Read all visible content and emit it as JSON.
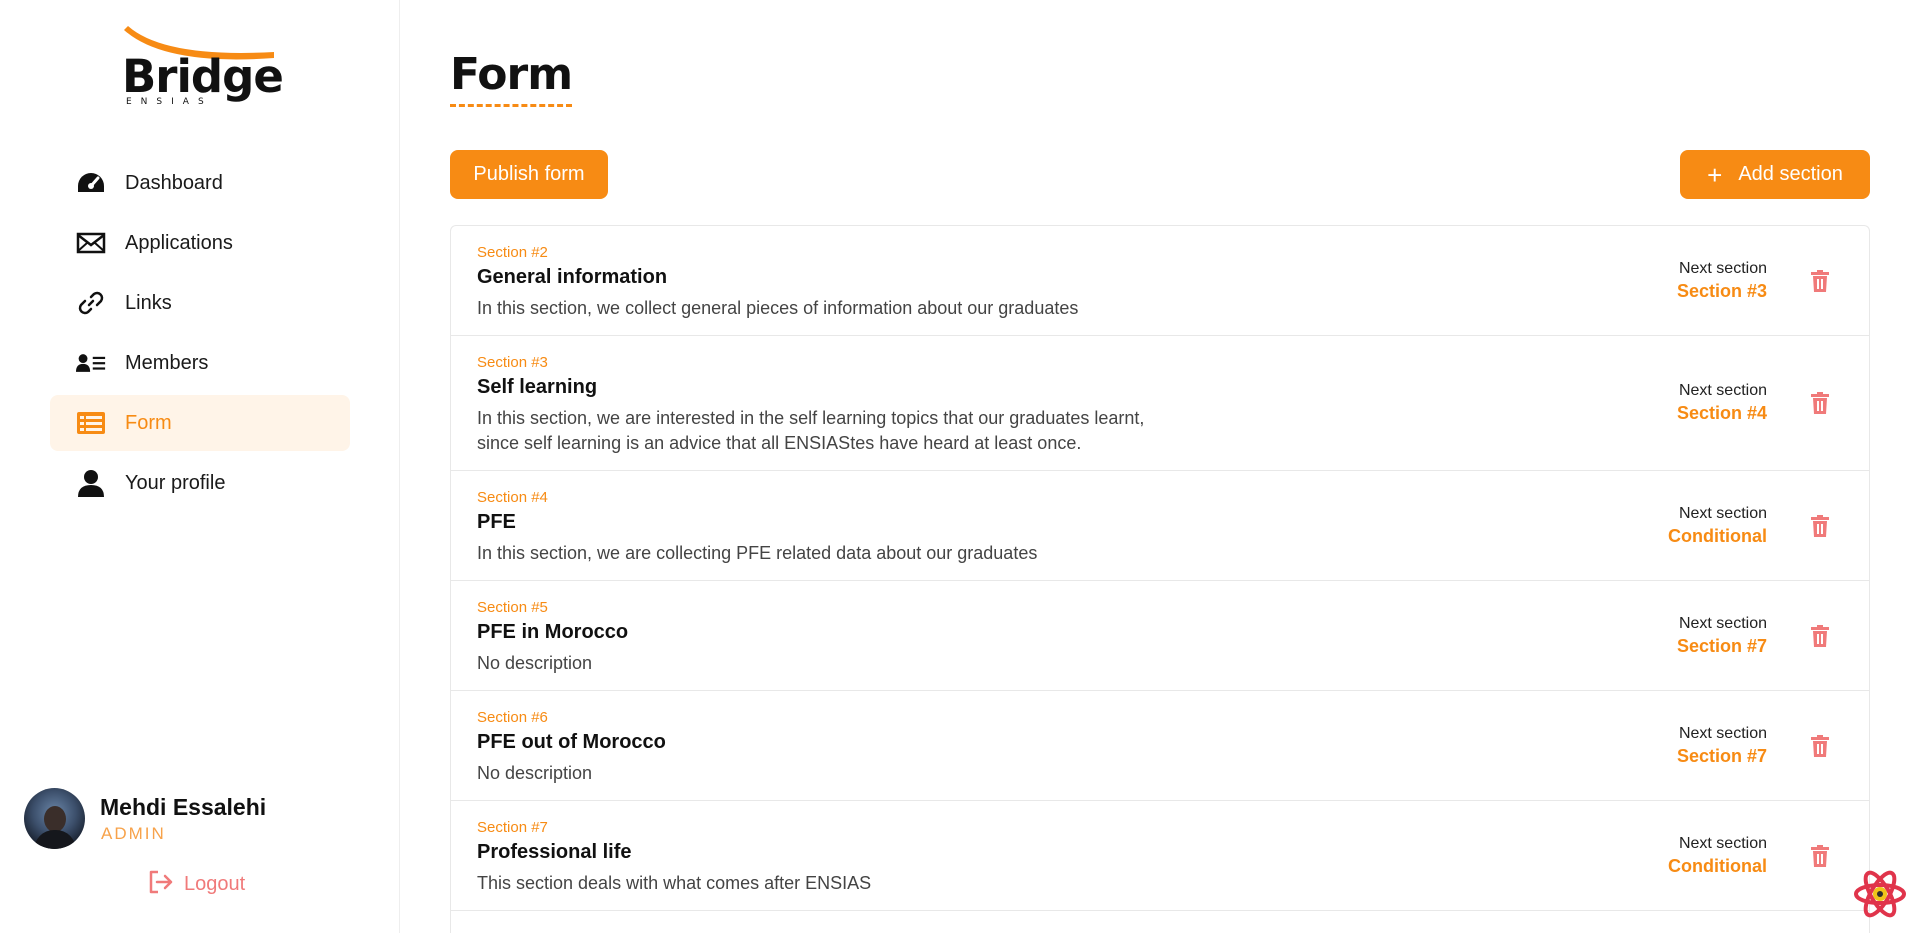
{
  "brand": {
    "name": "Bridge",
    "subtitle": "ENSIAS"
  },
  "colors": {
    "accent": "#f78b14",
    "danger": "#f07a7a"
  },
  "sidebar": {
    "items": [
      {
        "label": "Dashboard",
        "icon": "gauge-icon",
        "active": false
      },
      {
        "label": "Applications",
        "icon": "envelope-icon",
        "active": false
      },
      {
        "label": "Links",
        "icon": "link-icon",
        "active": false
      },
      {
        "label": "Members",
        "icon": "members-icon",
        "active": false
      },
      {
        "label": "Form",
        "icon": "form-list-icon",
        "active": true
      },
      {
        "label": "Your profile",
        "icon": "user-icon",
        "active": false
      }
    ]
  },
  "user": {
    "name": "Mehdi Essalehi",
    "role": "ADMIN",
    "logout_label": "Logout"
  },
  "main": {
    "title": "Form",
    "publish_label": "Publish form",
    "add_section_label": "Add section",
    "next_section_label": "Next section",
    "sections": [
      {
        "number": "Section #2",
        "title": "General information",
        "description": "In this section, we collect general pieces of information about our graduates",
        "next": "Section #3"
      },
      {
        "number": "Section #3",
        "title": "Self learning",
        "description": "In this section, we are interested in the self learning topics that our graduates learnt, since self learning is an advice that all ENSIAStes have heard at least once.",
        "next": "Section #4"
      },
      {
        "number": "Section #4",
        "title": "PFE",
        "description": "In this section, we are collecting PFE related data about our graduates",
        "next": "Conditional"
      },
      {
        "number": "Section #5",
        "title": "PFE in Morocco",
        "description": "No description",
        "next": "Section #7"
      },
      {
        "number": "Section #6",
        "title": "PFE out of Morocco",
        "description": "No description",
        "next": "Section #7"
      },
      {
        "number": "Section #7",
        "title": "Professional life",
        "description": "This section deals with what comes after ENSIAS",
        "next": "Conditional"
      }
    ]
  }
}
